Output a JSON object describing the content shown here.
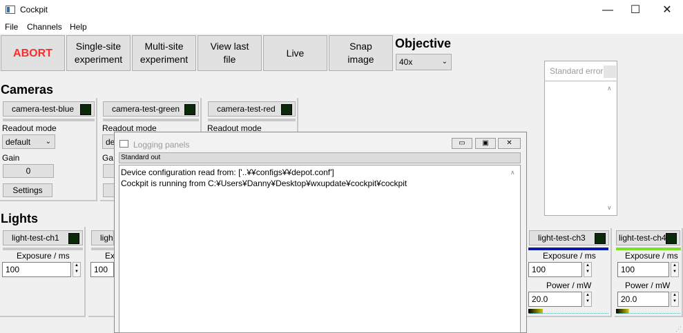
{
  "window": {
    "title": "Cockpit",
    "minimize": "—",
    "maximize": "☐",
    "close": "✕"
  },
  "menu": [
    "File",
    "Channels",
    "Help"
  ],
  "toolbar": {
    "abort": "ABORT",
    "single_site": "Single-site\nexperiment",
    "multi_site": "Multi-site\nexperiment",
    "view_last": "View last\nfile",
    "live": "Live",
    "snap": "Snap\nimage"
  },
  "objective": {
    "title": "Objective",
    "value": "40x"
  },
  "cameras": {
    "title": "Cameras",
    "items": [
      {
        "name": "camera-test-blue",
        "readout_label": "Readout mode",
        "readout_value": "default",
        "gain_label": "Gain",
        "gain_value": "0",
        "settings": "Settings"
      },
      {
        "name": "camera-test-green",
        "readout_label": "Readout mode",
        "readout_value": "de",
        "gain_label": "Ga"
      },
      {
        "name": "camera-test-red",
        "readout_label": "Readout mode"
      }
    ]
  },
  "lights": {
    "title": "Lights",
    "items": [
      {
        "name": "light-test-ch1",
        "exposure_label": "Exposure / ms",
        "exposure_value": "100"
      },
      {
        "name": "ligh",
        "exposure_label": "Ex",
        "exposure_value": "100"
      },
      {
        "name": "light-test-ch3",
        "exposure_label": "Exposure / ms",
        "exposure_value": "100",
        "power_label": "Power / mW",
        "power_value": "20.0",
        "color": "#0a1aa8"
      },
      {
        "name": "light-test-ch4",
        "exposure_label": "Exposure / ms",
        "exposure_value": "100",
        "power_label": "Power / mW",
        "power_value": "20.0",
        "color": "#7ee02a"
      }
    ]
  },
  "logging": {
    "title": "Logging panels",
    "tab": "Standard out",
    "lines": [
      "Device configuration read from: ['..¥¥configs¥¥depot.conf']",
      "Cockpit is running from C:¥Users¥Danny¥Desktop¥wxupdate¥cockpit¥cockpit"
    ]
  },
  "stderr": {
    "title": "Standard error"
  }
}
